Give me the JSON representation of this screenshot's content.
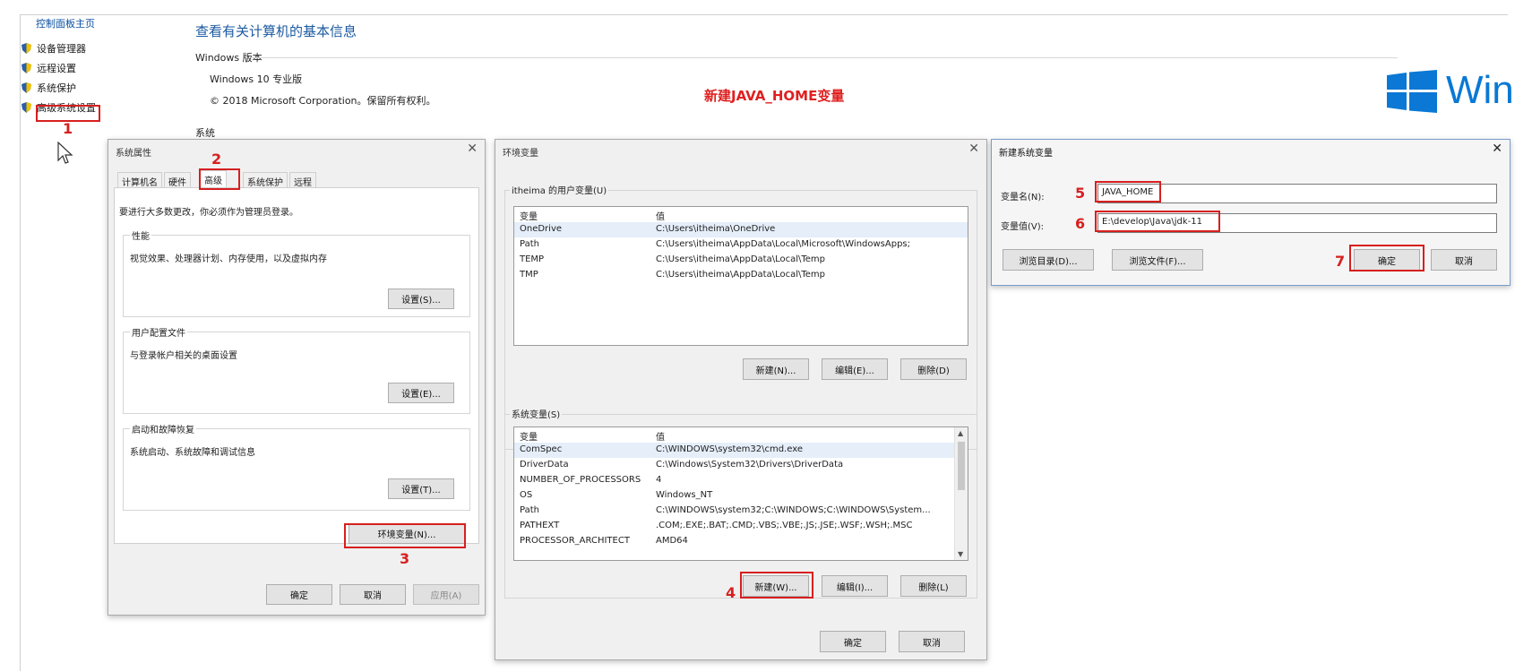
{
  "control_panel": {
    "home_link": "控制面板主页",
    "items": [
      {
        "label": "设备管理器"
      },
      {
        "label": "远程设置"
      },
      {
        "label": "系统保护"
      },
      {
        "label": "高级系统设置"
      }
    ],
    "page_title": "查看有关计算机的基本信息",
    "windows_edition_header": "Windows 版本",
    "edition": "Windows 10 专业版",
    "copyright": "© 2018 Microsoft Corporation。保留所有权利。",
    "system_header": "系统",
    "logo_text": "Win"
  },
  "annotation_title": "新建JAVA_HOME变量",
  "steps": [
    "1",
    "2",
    "3",
    "4",
    "5",
    "6",
    "7"
  ],
  "system_properties": {
    "title": "系统属性",
    "tabs": [
      "计算机名",
      "硬件",
      "高级",
      "系统保护",
      "远程"
    ],
    "admin_note": "要进行大多数更改，你必须作为管理员登录。",
    "performance": {
      "label": "性能",
      "desc": "视觉效果、处理器计划、内存使用，以及虚拟内存",
      "button": "设置(S)..."
    },
    "user_profiles": {
      "label": "用户配置文件",
      "desc": "与登录帐户相关的桌面设置",
      "button": "设置(E)..."
    },
    "startup": {
      "label": "启动和故障恢复",
      "desc": "系统启动、系统故障和调试信息",
      "button": "设置(T)..."
    },
    "env_button": "环境变量(N)...",
    "ok": "确定",
    "cancel": "取消",
    "apply": "应用(A)"
  },
  "env_vars": {
    "title": "环境变量",
    "user_group": "itheima 的用户变量(U)",
    "col_var": "变量",
    "col_val": "值",
    "user_rows": [
      {
        "name": "OneDrive",
        "value": "C:\\Users\\itheima\\OneDrive"
      },
      {
        "name": "Path",
        "value": "C:\\Users\\itheima\\AppData\\Local\\Microsoft\\WindowsApps;"
      },
      {
        "name": "TEMP",
        "value": "C:\\Users\\itheima\\AppData\\Local\\Temp"
      },
      {
        "name": "TMP",
        "value": "C:\\Users\\itheima\\AppData\\Local\\Temp"
      }
    ],
    "user_new": "新建(N)...",
    "user_edit": "编辑(E)...",
    "user_delete": "删除(D)",
    "system_group": "系统变量(S)",
    "system_rows": [
      {
        "name": "ComSpec",
        "value": "C:\\WINDOWS\\system32\\cmd.exe"
      },
      {
        "name": "DriverData",
        "value": "C:\\Windows\\System32\\Drivers\\DriverData"
      },
      {
        "name": "NUMBER_OF_PROCESSORS",
        "value": "4"
      },
      {
        "name": "OS",
        "value": "Windows_NT"
      },
      {
        "name": "Path",
        "value": "C:\\WINDOWS\\system32;C:\\WINDOWS;C:\\WINDOWS\\System..."
      },
      {
        "name": "PATHEXT",
        "value": ".COM;.EXE;.BAT;.CMD;.VBS;.VBE;.JS;.JSE;.WSF;.WSH;.MSC"
      },
      {
        "name": "PROCESSOR_ARCHITECT",
        "value": "AMD64"
      }
    ],
    "sys_new": "新建(W)...",
    "sys_edit": "编辑(I)...",
    "sys_delete": "删除(L)",
    "ok": "确定",
    "cancel": "取消"
  },
  "new_var": {
    "title": "新建系统变量",
    "name_label": "变量名(N):",
    "name_value": "JAVA_HOME",
    "value_label": "变量值(V):",
    "value_value": "E:\\develop\\Java\\jdk-11",
    "browse_dir": "浏览目录(D)...",
    "browse_file": "浏览文件(F)...",
    "ok": "确定",
    "cancel": "取消"
  },
  "colors": {
    "annotation_red": "#d71f1f",
    "link_blue": "#1b5aa0",
    "win_blue": "#0a78d4"
  }
}
